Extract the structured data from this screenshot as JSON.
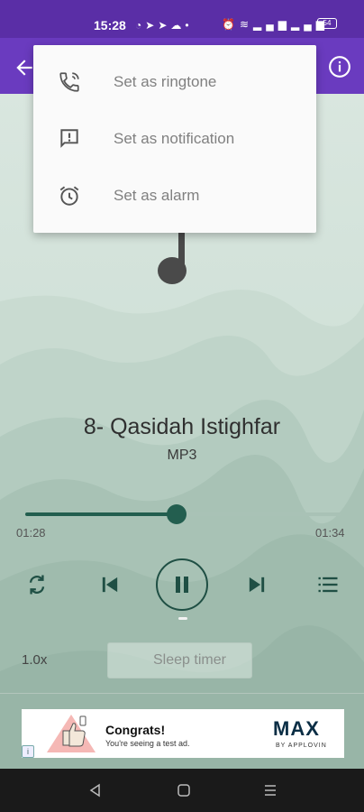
{
  "status_bar": {
    "time": "15:28",
    "left_icons": [
      "whatsapp-icon",
      "telegram-icon",
      "telegram-icon",
      "cloud-icon",
      "dot-icon"
    ],
    "right_icons": [
      "alarm-icon",
      "wifi-icon",
      "signal-icon",
      "signal-icon"
    ],
    "battery": "54"
  },
  "app_bar": {
    "color": "#6a3bbf"
  },
  "menu": {
    "items": [
      {
        "label": "Set as ringtone",
        "icon": "phone-ringtone-icon"
      },
      {
        "label": "Set as notification",
        "icon": "notification-message-icon"
      },
      {
        "label": "Set as alarm",
        "icon": "alarm-clock-icon"
      }
    ]
  },
  "player": {
    "title": "8- Qasidah Istighfar",
    "format": "MP3",
    "current_time": "01:28",
    "total_time": "01:34",
    "progress": 0.48,
    "speed": "1.0x",
    "sleep_timer_label": "Sleep timer",
    "accent_color": "#235e4f"
  },
  "ad": {
    "title": "Congrats!",
    "subtitle": "You're seeing a test ad.",
    "brand": "MAX",
    "brand_sub": "BY APPLOVIN",
    "adchoices": "i"
  }
}
